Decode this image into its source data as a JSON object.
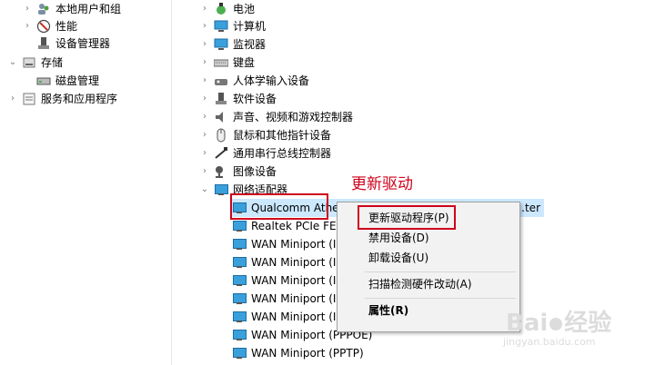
{
  "left_tree": [
    {
      "label": "本地用户和组",
      "icon": "users-icon"
    },
    {
      "label": "性能",
      "icon": "performance-icon"
    },
    {
      "label": "设备管理器",
      "icon": "device-manager-icon"
    },
    {
      "label": "存储",
      "icon": "storage-icon"
    },
    {
      "label": "磁盘管理",
      "icon": "disk-icon"
    },
    {
      "label": "服务和应用程序",
      "icon": "services-icon"
    }
  ],
  "device_categories": [
    {
      "label": "电池",
      "icon": "battery-icon"
    },
    {
      "label": "计算机",
      "icon": "computer-icon"
    },
    {
      "label": "监视器",
      "icon": "monitor-icon"
    },
    {
      "label": "键盘",
      "icon": "keyboard-icon"
    },
    {
      "label": "人体学输入设备",
      "icon": "hid-icon"
    },
    {
      "label": "软件设备",
      "icon": "software-device-icon"
    },
    {
      "label": "声音、视频和游戏控制器",
      "icon": "sound-icon"
    },
    {
      "label": "鼠标和其他指针设备",
      "icon": "mouse-icon"
    },
    {
      "label": "通用串行总线控制器",
      "icon": "usb-icon"
    },
    {
      "label": "图像设备",
      "icon": "camera-icon"
    },
    {
      "label": "网络适配器",
      "icon": "network-adapter-icon"
    }
  ],
  "network_adapters": [
    "Qualcomm Athe",
    "Realtek PCIe FE",
    "WAN Miniport (I",
    "WAN Miniport (I",
    "WAN Miniport (I",
    "WAN Miniport (I",
    "WAN Miniport (I",
    "WAN Miniport (PPPOE)",
    "WAN Miniport (PPTP)"
  ],
  "selected_adapter_tail": "...ter",
  "context_menu": {
    "update_driver": "更新驱动程序(P)",
    "disable_device": "禁用设备(D)",
    "uninstall_device": "卸载设备(U)",
    "scan_hardware": "扫描检测硬件改动(A)",
    "properties": "属性(R)"
  },
  "annotation": "更新驱动",
  "watermark": {
    "brand": "Bai",
    "brand2": "经验",
    "url": "jingyan.baidu.com"
  },
  "colors": {
    "highlight": "#d0021b",
    "selection": "#cce8ff",
    "menu_bg": "#f2f2f2"
  }
}
